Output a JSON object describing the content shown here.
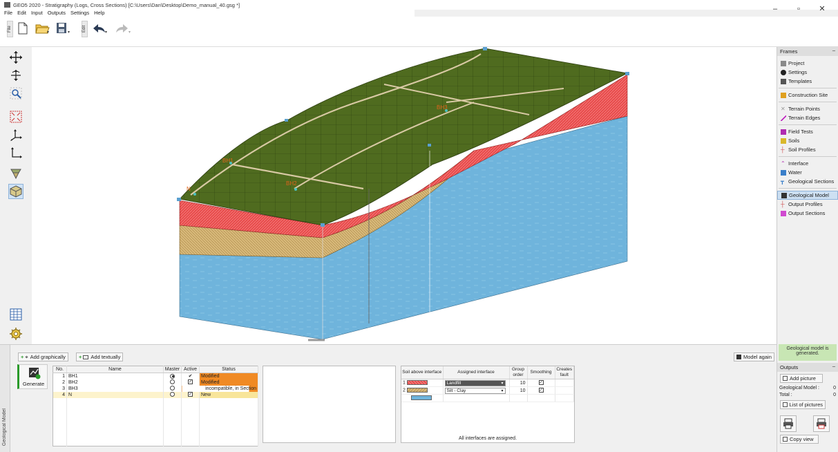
{
  "window": {
    "title": "GEO5 2020 - Stratigraphy (Logs, Cross Sections) [C:\\Users\\Dan\\Desktop\\Demo_manual_40.gsg *]",
    "controls": [
      "–",
      "▫",
      "✕"
    ]
  },
  "menu": [
    "File",
    "Edit",
    "Input",
    "Outputs",
    "Settings",
    "Help"
  ],
  "toolbar": {
    "file_tab": "File",
    "edit_tab": "Edit"
  },
  "canvas": {
    "labels": {
      "bh1": "BH1",
      "bh2": "BH2",
      "bh3": "BH3",
      "n": "N"
    },
    "colors": {
      "terrain": "#4f6b1f",
      "landfill": "#e84b4b",
      "silt": "#d8b97a",
      "water": "#6fb4dc"
    }
  },
  "frames": {
    "header": "Frames",
    "items": [
      {
        "label": "Project",
        "icon": "project-icon"
      },
      {
        "label": "Settings",
        "icon": "settings-icon"
      },
      {
        "label": "Templates",
        "icon": "templates-icon"
      },
      {
        "label": "Construction Site",
        "icon": "construction-site-icon"
      },
      {
        "label": "Terrain Points",
        "icon": "terrain-points-icon"
      },
      {
        "label": "Terrain Edges",
        "icon": "terrain-edges-icon"
      },
      {
        "label": "Field Tests",
        "icon": "field-tests-icon"
      },
      {
        "label": "Soils",
        "icon": "soils-icon"
      },
      {
        "label": "Soil Profiles",
        "icon": "soil-profiles-icon"
      },
      {
        "label": "Interface",
        "icon": "interface-icon"
      },
      {
        "label": "Water",
        "icon": "water-icon"
      },
      {
        "label": "Geological Sections",
        "icon": "geological-sections-icon"
      },
      {
        "label": "Geological Model",
        "icon": "geological-model-icon"
      },
      {
        "label": "Output Profiles",
        "icon": "output-profiles-icon"
      },
      {
        "label": "Output Sections",
        "icon": "output-sections-icon"
      }
    ],
    "status": "Geological model is generated."
  },
  "outputs": {
    "header": "Outputs",
    "add_picture": "Add picture",
    "geo_model_label": "Geological Model :",
    "geo_model_value": "0",
    "total_label": "Total :",
    "total_value": "0",
    "list_of_pictures": "List of pictures",
    "copy_view": "Copy view"
  },
  "bottom": {
    "tab_label": "Geological Model",
    "add_graphically": "Add graphically",
    "add_textually": "Add textually",
    "generate": "Generate",
    "model_again": "Model again",
    "boreholes": {
      "headers": [
        "No.",
        "Name",
        "Master",
        "Active",
        "Status"
      ],
      "rows": [
        {
          "no": "1",
          "name": "BH1",
          "status": "Modified"
        },
        {
          "no": "2",
          "name": "BH2",
          "status": "Modified"
        },
        {
          "no": "3",
          "name": "BH3",
          "status": "incompatible, in Section"
        },
        {
          "no": "4",
          "name": "N",
          "status": "New"
        }
      ]
    },
    "interfaces": {
      "headers": [
        "Soil above interface",
        "Assigned interface",
        "Group order",
        "Smoothing",
        "Creates fault"
      ],
      "rows": [
        {
          "no": "1",
          "assigned": "Landfill",
          "order": "10"
        },
        {
          "no": "2",
          "assigned": "Silt - Clay",
          "order": "10"
        }
      ],
      "footer": "All interfaces are assigned."
    }
  }
}
